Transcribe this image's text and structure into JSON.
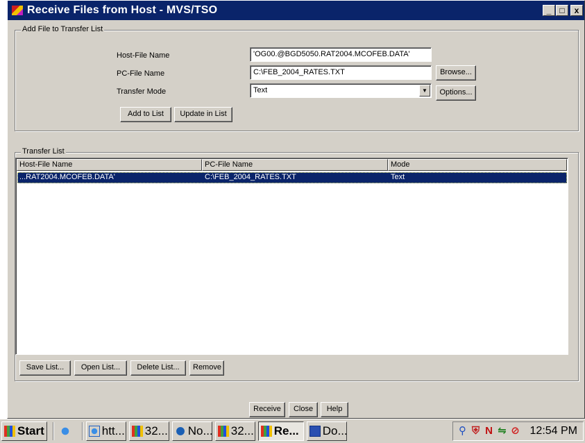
{
  "window": {
    "title": "Receive Files from Host - MVS/TSO",
    "minimize": "_",
    "maximize": "ƒ",
    "close": "x"
  },
  "add_group": {
    "legend": "Add File to Transfer List",
    "host_file_label": "Host-File Name",
    "host_file_value": "'OG00.@BGD5050.RAT2004.MCOFEB.DATA'",
    "pc_file_label": "PC-File Name",
    "pc_file_value": "C:\\FEB_2004_RATES.TXT",
    "transfer_mode_label": "Transfer Mode",
    "transfer_mode_value": "Text",
    "browse_button": "Browse...",
    "options_button": "Options...",
    "add_to_list_button": "Add to List",
    "update_in_list_button": "Update in List"
  },
  "transfer_list": {
    "legend": "Transfer List",
    "columns": [
      "Host-File Name",
      "PC-File Name",
      "Mode"
    ],
    "rows": [
      {
        "host": "...RAT2004.MCOFEB.DATA'",
        "pc": "C:\\FEB_2004_RATES.TXT",
        "mode": "Text"
      }
    ],
    "save_list_button": "Save List...",
    "open_list_button": "Open List...",
    "delete_list_button": "Delete List...",
    "remove_button": "Remove"
  },
  "footer_buttons": {
    "receive": "Receive",
    "close": "Close",
    "help": "Help"
  },
  "taskbar": {
    "start": "Start",
    "tasks": [
      {
        "label": "htt...",
        "icon": "ie-icon"
      },
      {
        "label": "32...",
        "icon": "host-icon"
      },
      {
        "label": "No...",
        "icon": "globe-icon"
      },
      {
        "label": "32...",
        "icon": "host-icon"
      },
      {
        "label": "Re...",
        "icon": "host-icon",
        "active": true
      },
      {
        "label": "Do...",
        "icon": "word-icon"
      }
    ],
    "clock": "12:54 PM"
  },
  "colors": {
    "title_bar": "#0a246a",
    "face": "#d4d0c8",
    "selection": "#0a246a"
  }
}
